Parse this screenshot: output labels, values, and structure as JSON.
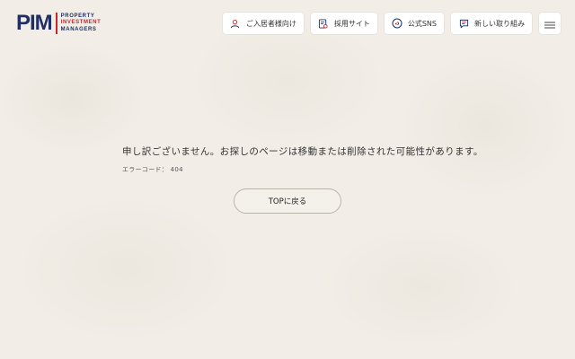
{
  "header": {
    "logo": {
      "mark": "PIM",
      "line1": "PROPERTY",
      "line2": "INVESTMENT",
      "line3": "MANAGERS"
    },
    "nav": [
      {
        "label": "ご入居者様向け",
        "icon": "person-icon"
      },
      {
        "label": "採用サイト",
        "icon": "recruit-icon"
      },
      {
        "label": "公式SNS",
        "icon": "sns-icon"
      },
      {
        "label": "新しい取り組み",
        "icon": "chat-icon"
      }
    ],
    "menu_icon": "hamburger-menu-icon"
  },
  "main": {
    "message": "申し訳ございません。お探しのページは移動または削除された可能性があります。",
    "error_code": "エラーコード： 404",
    "top_button": "TOPに戻る"
  },
  "colors": {
    "brand_navy": "#1f2f63",
    "brand_red": "#c9252c",
    "background": "#f2eee7"
  }
}
